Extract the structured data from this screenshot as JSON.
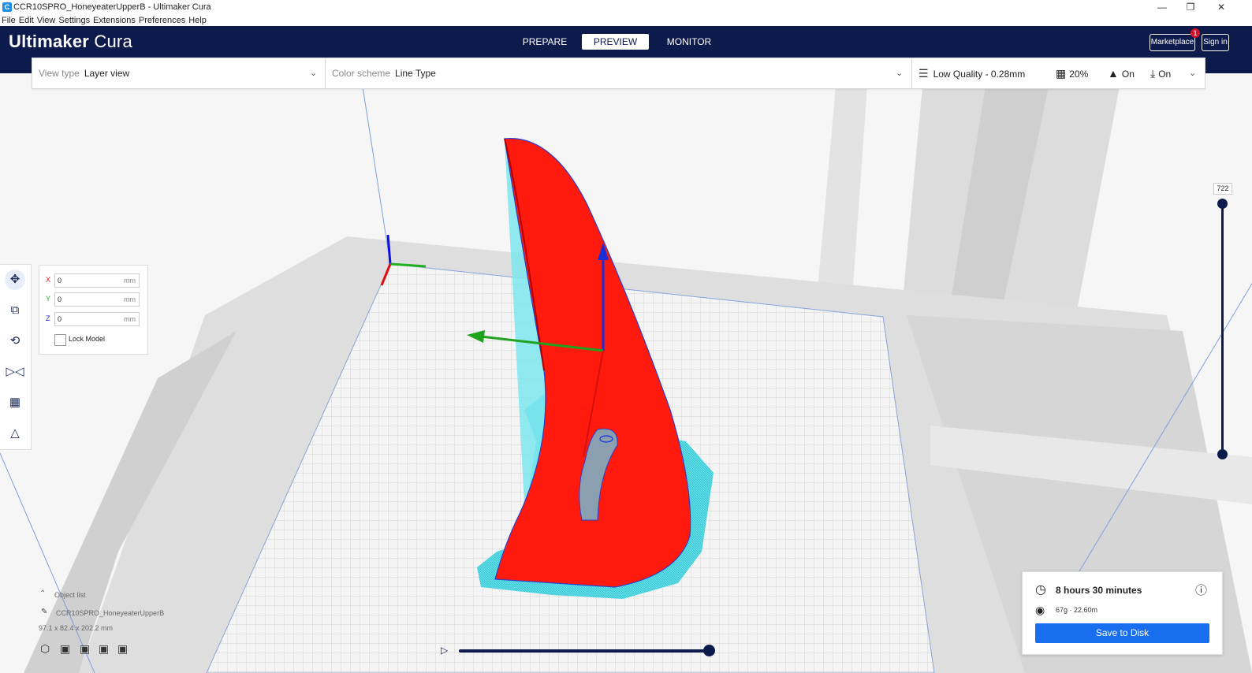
{
  "window": {
    "title": "CCR10SPRO_HoneyeaterUpperB - Ultimaker Cura",
    "icon": "cura-app-icon",
    "controls": [
      "minimize-icon",
      "restore-icon",
      "close-icon"
    ]
  },
  "menubar": [
    "File",
    "Edit",
    "View",
    "Settings",
    "Extensions",
    "Preferences",
    "Help"
  ],
  "header": {
    "logo_brand": "Ultimaker",
    "logo_product": "Cura",
    "stages": [
      "PREPARE",
      "PREVIEW",
      "MONITOR"
    ],
    "active_stage": "PREVIEW",
    "marketplace_label": "Marketplace",
    "marketplace_badge": "1",
    "signin_label": "Sign in"
  },
  "toolbar": {
    "view_type_label": "View type",
    "view_type_value": "Layer view",
    "color_scheme_label": "Color scheme",
    "color_scheme_value": "Line Type",
    "quality": "Low Quality - 0.28mm",
    "infill": "20%",
    "support": "On",
    "adhesion": "On"
  },
  "move_panel": {
    "x_label": "X",
    "x_value": "0",
    "y_label": "Y",
    "y_value": "0",
    "z_label": "Z",
    "z_value": "0",
    "unit": "mm",
    "lock_label": "Lock Model"
  },
  "tools": [
    "move-tool",
    "scale-tool",
    "rotate-tool",
    "mirror-tool",
    "per-model-settings-tool",
    "support-blocker-tool"
  ],
  "object_list": {
    "header": "Object list",
    "object_name": "CCR10SPRO_HoneyeaterUpperB",
    "dimensions": "97.1 x 82.4 x 202.2 mm"
  },
  "layer_slider": {
    "value": "722"
  },
  "estimate": {
    "time": "8 hours 30 minutes",
    "material": "67g · 22.60m",
    "save_label": "Save to Disk"
  },
  "colors": {
    "header_bg": "#0d1b4c",
    "accent_blue": "#196ef0",
    "model_red": "#ff1a0d",
    "support_cyan": "#48d4de",
    "axis_x": "#e01010",
    "axis_y": "#20b020",
    "axis_z": "#1010e0"
  }
}
